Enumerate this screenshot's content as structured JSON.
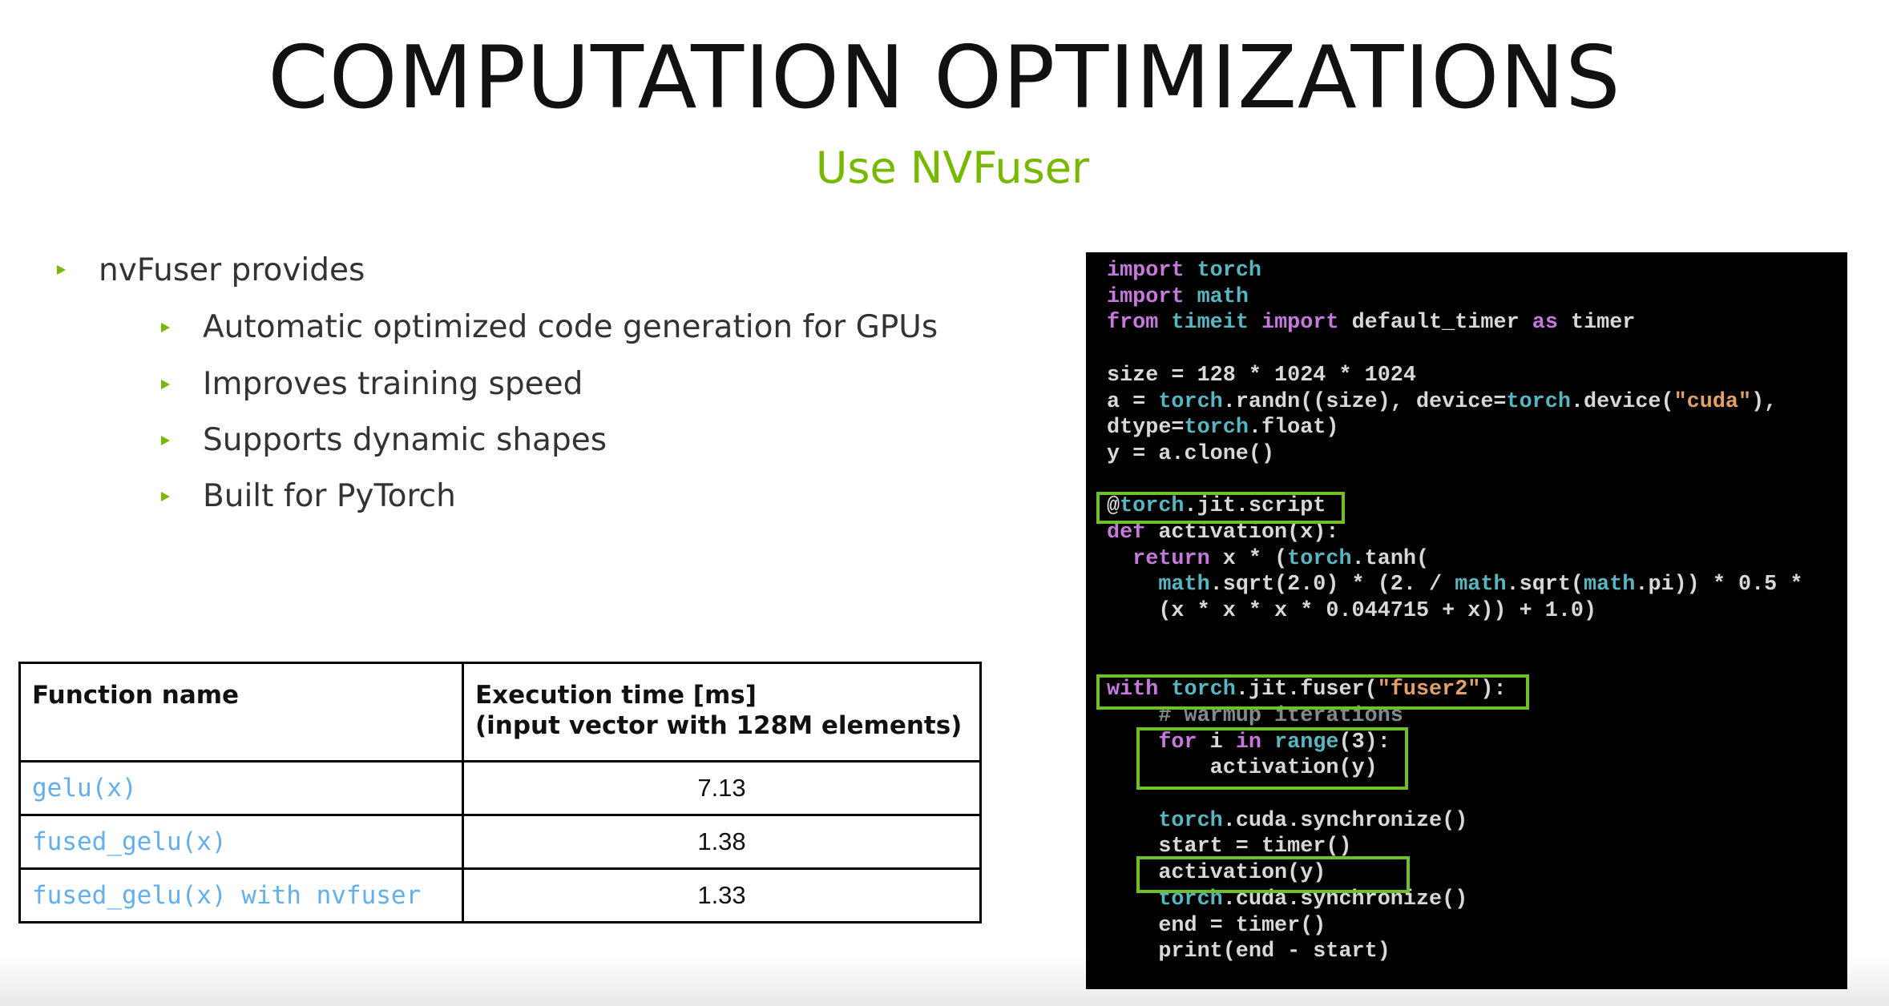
{
  "title": "COMPUTATION OPTIMIZATIONS",
  "subtitle": "Use NVFuser",
  "accent_color": "#76b900",
  "bullets": {
    "main": "nvFuser provides",
    "sub": [
      "Automatic optimized code generation for GPUs",
      "Improves training speed",
      "Supports dynamic shapes",
      "Built for PyTorch"
    ]
  },
  "table": {
    "headers": [
      "Function name",
      "Execution time [ms]",
      "(input vector with 128M elements)"
    ],
    "rows": [
      {
        "name": "gelu(x)",
        "time": "7.13"
      },
      {
        "name": "fused_gelu(x)",
        "time": "1.38"
      },
      {
        "name": "fused_gelu(x) with nvfuser",
        "time": "1.33"
      }
    ]
  },
  "code_lines": [
    "import torch",
    "import math",
    "from timeit import default_timer as timer",
    "",
    "size = 128 * 1024 * 1024",
    "a = torch.randn((size), device=torch.device(\"cuda\"),",
    "dtype=torch.float)",
    "y = a.clone()",
    "",
    "@torch.jit.script",
    "def activation(x):",
    "  return x * (torch.tanh(",
    "    math.sqrt(2.0) * (2. / math.sqrt(math.pi)) * 0.5 *",
    "    (x * x * x * 0.044715 + x)) + 1.0)",
    "",
    "",
    "with torch.jit.fuser(\"fuser2\"):",
    "    # warmup iterations",
    "    for i in range(3):",
    "        activation(y)",
    "",
    "    torch.cuda.synchronize()",
    "    start = timer()",
    "    activation(y)",
    "    torch.cuda.synchronize()",
    "    end = timer()",
    "    print(end - start)"
  ]
}
